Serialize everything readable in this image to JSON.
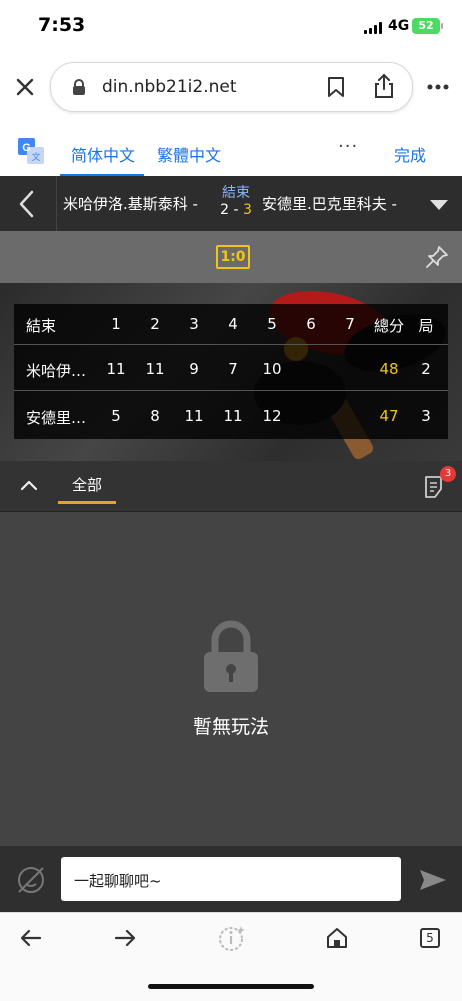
{
  "status_bar": {
    "time": "7:53",
    "network": "4G",
    "battery": "52"
  },
  "browser": {
    "url": "din.nbb21i2.net"
  },
  "translate_bar": {
    "tab_simplified": "简体中文",
    "tab_traditional": "繁體中文",
    "more": "···",
    "done": "完成"
  },
  "match": {
    "home_team": "米哈伊洛.基斯泰科 -",
    "away_team": "安德里.巴克里科夫 -",
    "status": "結束",
    "score_home": "2",
    "score_sep": " - ",
    "score_away": "3",
    "set_score_badge": "1:0"
  },
  "score_table": {
    "headers": [
      "結束",
      "1",
      "2",
      "3",
      "4",
      "5",
      "6",
      "7",
      "總分",
      "局"
    ],
    "rows": [
      {
        "name": "米哈伊…",
        "sets": [
          "11",
          "11",
          "9",
          "7",
          "10",
          "",
          ""
        ],
        "total": "48",
        "games": "2"
      },
      {
        "name": "安德里…",
        "sets": [
          "5",
          "8",
          "11",
          "11",
          "12",
          "",
          ""
        ],
        "total": "47",
        "games": "3"
      }
    ]
  },
  "tabs": {
    "all": "全部",
    "notes_badge": "3"
  },
  "empty_state": {
    "text": "暫無玩法"
  },
  "chat": {
    "placeholder": "一起聊聊吧~"
  },
  "bottom_nav": {
    "tab_count": "5"
  },
  "colors": {
    "accent_yellow": "#f0c419",
    "link_blue": "#1a73e8",
    "tab_orange": "#f0a02a",
    "badge_red": "#e53935"
  }
}
